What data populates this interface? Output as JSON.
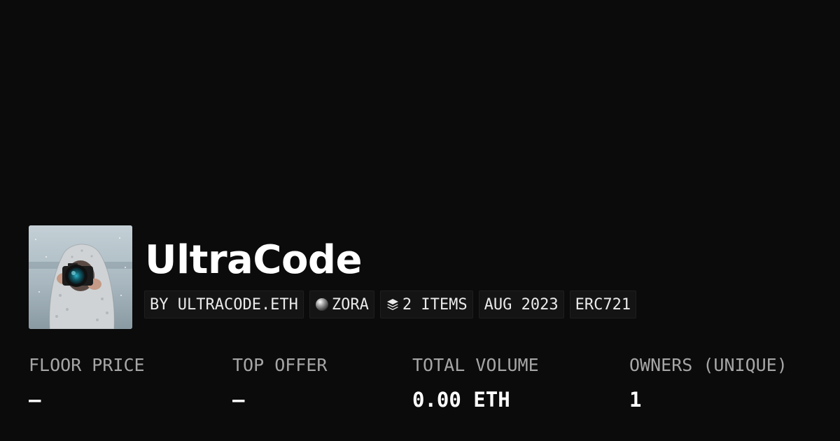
{
  "collection": {
    "name": "UltraCode",
    "image_icon": "camera-photographer-avatar"
  },
  "tags": {
    "creator": "BY ULTRACODE.ETH",
    "network": {
      "label": "ZORA",
      "icon": "zora-orb-icon"
    },
    "items": {
      "label": "2 ITEMS",
      "icon": "layers-icon"
    },
    "date": "AUG 2023",
    "standard": "ERC721"
  },
  "stats": {
    "floor_price": {
      "label": "FLOOR PRICE",
      "value": "—"
    },
    "top_offer": {
      "label": "TOP OFFER",
      "value": "—"
    },
    "total_volume": {
      "label": "TOTAL VOLUME",
      "value": "0.00 ETH"
    },
    "owners": {
      "label": "OWNERS (UNIQUE)",
      "value": "1"
    }
  },
  "colors": {
    "background": "#0b0b0b",
    "tag_background": "#141414",
    "label": "#a6a6a6",
    "text": "#ffffff"
  }
}
